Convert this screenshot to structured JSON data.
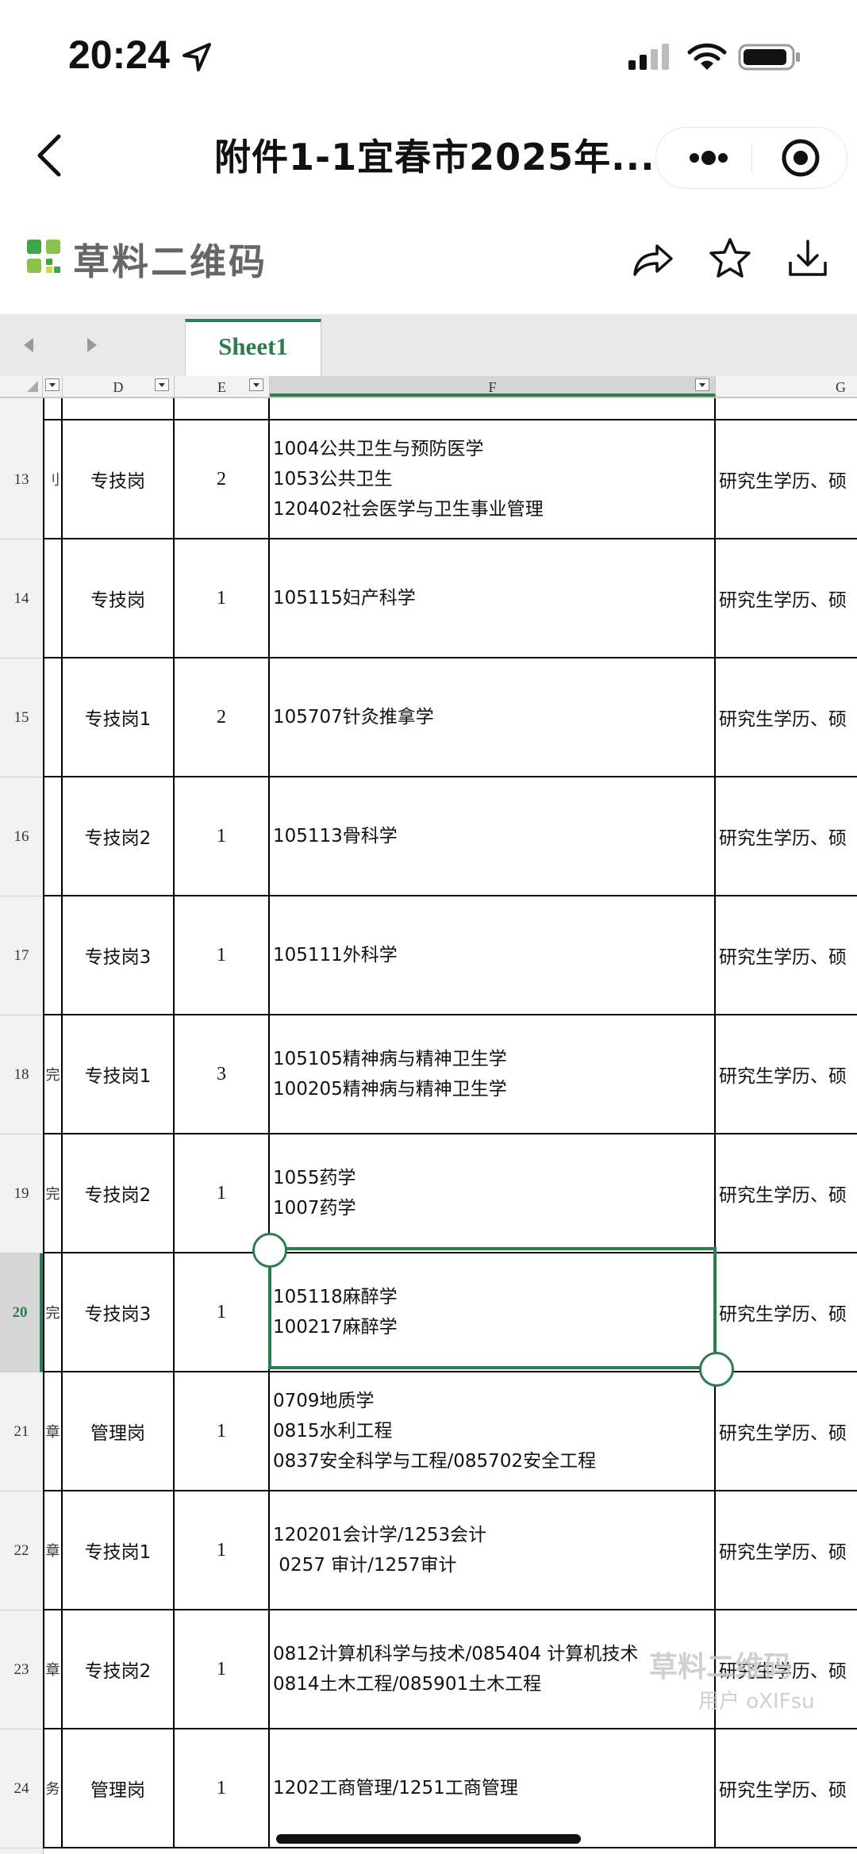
{
  "status_bar": {
    "time": "20:24"
  },
  "title_bar": {
    "title": "附件1-1宜春市2025年..."
  },
  "app_toolbar": {
    "brand": "草料二维码"
  },
  "sheet": {
    "tab_name": "Sheet1",
    "columns": [
      "D",
      "E",
      "F",
      "G"
    ],
    "selected_column": "F",
    "rows": [
      {
        "num": "13",
        "c": "刂",
        "d": "专技岗",
        "e": "2",
        "f": [
          "1004公共卫生与预防医学",
          "1053公共卫生",
          "120402社会医学与卫生事业管理"
        ],
        "g": "研究生学历、硕"
      },
      {
        "num": "14",
        "c": "",
        "d": "专技岗",
        "e": "1",
        "f": [
          "105115妇产科学"
        ],
        "g": "研究生学历、硕"
      },
      {
        "num": "15",
        "c": "",
        "d": "专技岗1",
        "e": "2",
        "f": [
          "105707针灸推拿学"
        ],
        "g": "研究生学历、硕"
      },
      {
        "num": "16",
        "c": "",
        "d": "专技岗2",
        "e": "1",
        "f": [
          "105113骨科学"
        ],
        "g": "研究生学历、硕"
      },
      {
        "num": "17",
        "c": "",
        "d": "专技岗3",
        "e": "1",
        "f": [
          "105111外科学"
        ],
        "g": "研究生学历、硕"
      },
      {
        "num": "18",
        "c": "完",
        "d": "专技岗1",
        "e": "3",
        "f": [
          "105105精神病与精神卫生学",
          "100205精神病与精神卫生学"
        ],
        "g": "研究生学历、硕"
      },
      {
        "num": "19",
        "c": "完",
        "d": "专技岗2",
        "e": "1",
        "f": [
          "1055药学",
          "1007药学"
        ],
        "g": "研究生学历、硕"
      },
      {
        "num": "20",
        "c": "完",
        "d": "专技岗3",
        "e": "1",
        "f": [
          "105118麻醉学",
          "100217麻醉学"
        ],
        "g": "研究生学历、硕"
      },
      {
        "num": "21",
        "c": "章",
        "d": "管理岗",
        "e": "1",
        "f": [
          "0709地质学",
          "0815水利工程",
          "0837安全科学与工程/085702安全工程"
        ],
        "g": "研究生学历、硕"
      },
      {
        "num": "22",
        "c": "章",
        "d": "专技岗1",
        "e": "1",
        "f": [
          "120201会计学/1253会计",
          " 0257 审计/1257审计"
        ],
        "g": "研究生学历、硕"
      },
      {
        "num": "23",
        "c": "章",
        "d": "专技岗2",
        "e": "1",
        "f": [
          "0812计算机科学与技术/085404 计算机技术",
          "0814土木工程/085901土木工程"
        ],
        "g": "研究生学历、硕"
      },
      {
        "num": "24",
        "c": "务",
        "d": "管理岗",
        "e": "1",
        "f": [
          "1202工商管理/1251工商管理"
        ],
        "g": "研究生学历、硕"
      }
    ],
    "selected_row": "20"
  },
  "watermark": {
    "line1": "草料二维码",
    "line2": "用户 oXIFsu"
  },
  "colors": {
    "accent": "#2e7d4f",
    "grid_line": "#000000"
  },
  "icons": [
    "location-arrow-icon",
    "signal-icon",
    "wifi-icon",
    "battery-icon",
    "back-icon",
    "more-icon",
    "close-circle-icon",
    "share-icon",
    "star-icon",
    "download-icon"
  ]
}
